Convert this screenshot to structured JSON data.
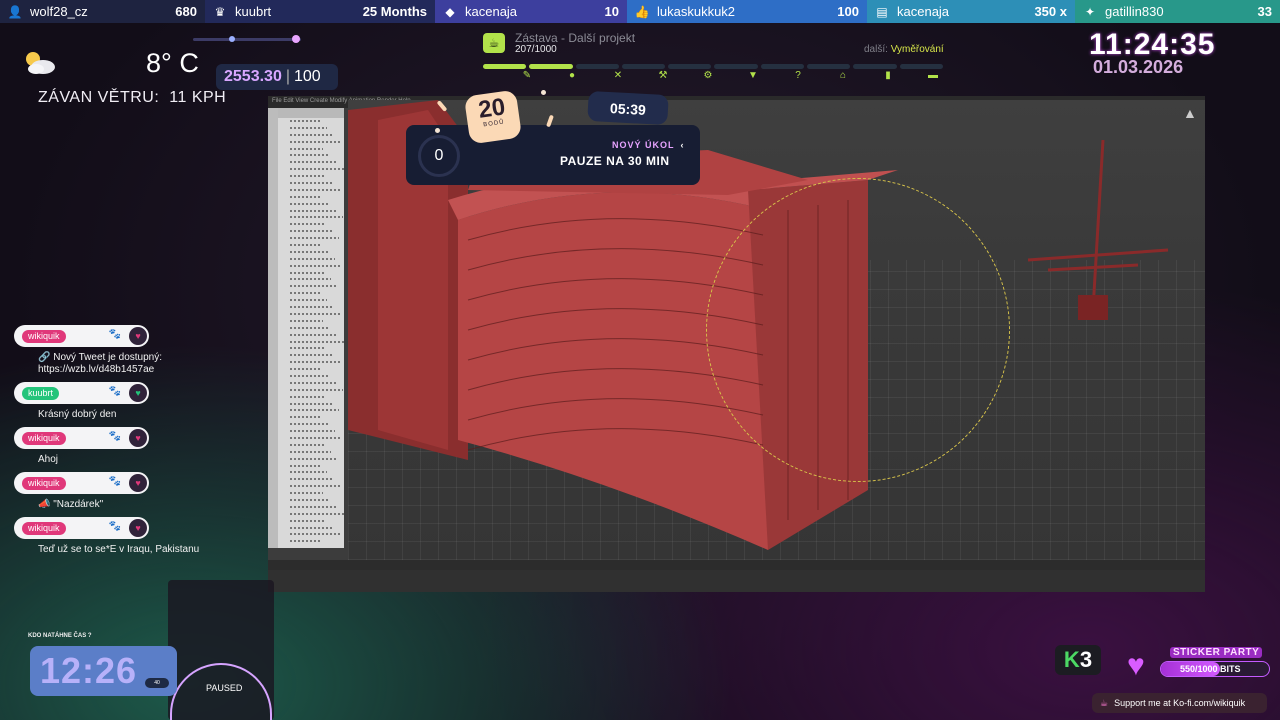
{
  "topbar": [
    {
      "icon": "user-plus-icon",
      "name": "wolf28_cz",
      "value": "680",
      "bg": "#1e2340"
    },
    {
      "icon": "crown-icon",
      "name": "kuubrt",
      "value": "25 Months",
      "bg": "#22295a"
    },
    {
      "icon": "diamond-icon",
      "name": "kacenaja",
      "value": "10",
      "bg": "#3d3f9e"
    },
    {
      "icon": "thumbs-up-icon",
      "name": "lukaskukkuk2",
      "value": "100",
      "bg": "#2e6ec6"
    },
    {
      "icon": "stack-icon",
      "name": "kacenaja",
      "value": "350 x",
      "bg": "#2d8fb7"
    },
    {
      "icon": "gamepad-icon",
      "name": "gatillin830",
      "value": "33",
      "bg": "#28988a"
    }
  ],
  "weather": {
    "temp": "8° C",
    "wind_label": "ZÁVAN VĚTRU:",
    "wind_value": "11 KPH"
  },
  "score": {
    "current": "2553.30",
    "max": "100"
  },
  "project": {
    "title": "Zástava - Další projekt",
    "count": "207/1000",
    "next_label": "další:",
    "next_value": "Vyměřování",
    "steps_done": 2,
    "steps_total": 10
  },
  "clock": {
    "time": "11:24:35",
    "date": "01.03.2026"
  },
  "task": {
    "points": "20",
    "points_label": "BODŮ",
    "timer": "05:39",
    "counter": "0",
    "label": "NOVÝ ÚKOL",
    "title": "PAUZE NA 30 MIN"
  },
  "chat": [
    {
      "user": "wikiquik",
      "color": "#e0387a",
      "text": "🔗 Nový Tweet je dostupný: https://wzb.lv/d48b1457ae"
    },
    {
      "user": "kuubrt",
      "color": "#23c47a",
      "text": "Krásný dobrý den"
    },
    {
      "user": "wikiquik",
      "color": "#e0387a",
      "text": "Ahoj"
    },
    {
      "user": "wikiquik",
      "color": "#e0387a",
      "text": "📣 \"Nazdárek\""
    },
    {
      "user": "wikiquik",
      "color": "#e0387a",
      "text": "Teď už se to se*E v Iraqu, Pakistanu"
    }
  ],
  "stretch": {
    "label": "KDO NATÁHNE ČAS ?",
    "time": "12:26",
    "pill": "40"
  },
  "paused": "PAUSED",
  "sticker": {
    "title": "STICKER PARTY",
    "value": "550/1000 BITS",
    "progress": 0.55
  },
  "kofi": "Support me at Ko-fi.com/wikiquik",
  "k3": {
    "k": "K",
    "three": "3"
  }
}
